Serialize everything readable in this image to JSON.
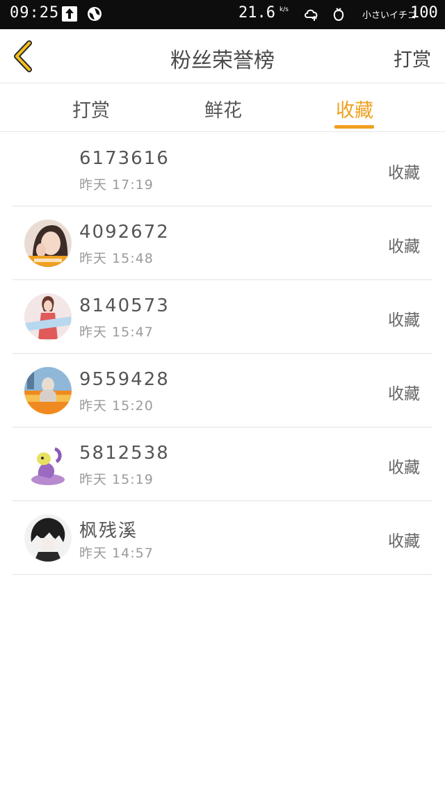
{
  "status_bar": {
    "time": "09:25",
    "speed": "21.6",
    "speed_unit": "k/s",
    "carrier": "小さいイチゴ",
    "battery": "100"
  },
  "header": {
    "title": "粉丝荣誉榜",
    "right_link": "打赏"
  },
  "tabs": [
    {
      "label": "打赏",
      "active": false
    },
    {
      "label": "鲜花",
      "active": false
    },
    {
      "label": "收藏",
      "active": true
    }
  ],
  "accent_color": "#f0a020",
  "fans": [
    {
      "name": "6173616",
      "time": "昨天 17:19",
      "action": "收藏",
      "avatar": "none"
    },
    {
      "name": "4092672",
      "time": "昨天 15:48",
      "action": "收藏",
      "avatar": "girl-photo"
    },
    {
      "name": "8140573",
      "time": "昨天 15:47",
      "action": "收藏",
      "avatar": "woman-photo"
    },
    {
      "name": "9559428",
      "time": "昨天 15:20",
      "action": "收藏",
      "avatar": "scenery-photo"
    },
    {
      "name": "5812538",
      "time": "昨天 15:19",
      "action": "收藏",
      "avatar": "cartoon-character"
    },
    {
      "name": "枫残溪",
      "time": "昨天 14:57",
      "action": "收藏",
      "avatar": "anime-boy"
    }
  ]
}
